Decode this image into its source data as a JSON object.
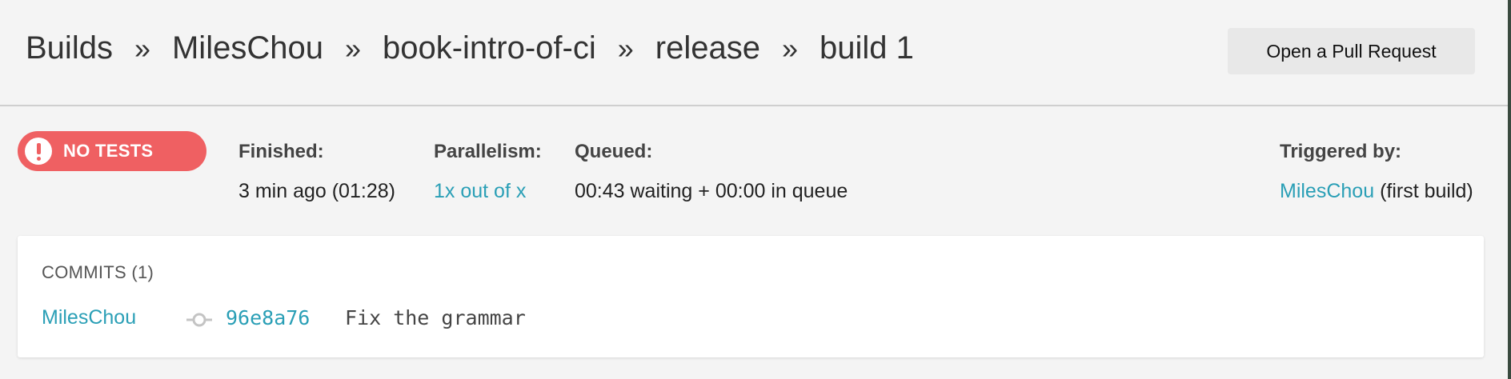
{
  "breadcrumb": {
    "items": [
      "Builds",
      "MilesChou",
      "book-intro-of-ci",
      "release",
      "build 1"
    ],
    "separator": "»"
  },
  "header": {
    "pr_button_label": "Open a Pull Request"
  },
  "status": {
    "label": "NO TESTS",
    "icon": "exclamation-icon",
    "color": "#ef6062"
  },
  "meta": {
    "finished": {
      "label": "Finished:",
      "value": "3 min ago (01:28)"
    },
    "parallelism": {
      "label": "Parallelism:",
      "value": "1x out of x"
    },
    "queued": {
      "label": "Queued:",
      "value": "00:43 waiting + 00:00 in queue"
    },
    "triggered": {
      "label": "Triggered by:",
      "user": "MilesChou",
      "suffix": "(first build)"
    }
  },
  "commits": {
    "title": "COMMITS (1)",
    "items": [
      {
        "author": "MilesChou",
        "sha": "96e8a76",
        "message": "Fix the grammar"
      }
    ]
  },
  "colors": {
    "accent": "#2a9fb6",
    "status": "#ef6062",
    "background": "#f4f4f4"
  }
}
